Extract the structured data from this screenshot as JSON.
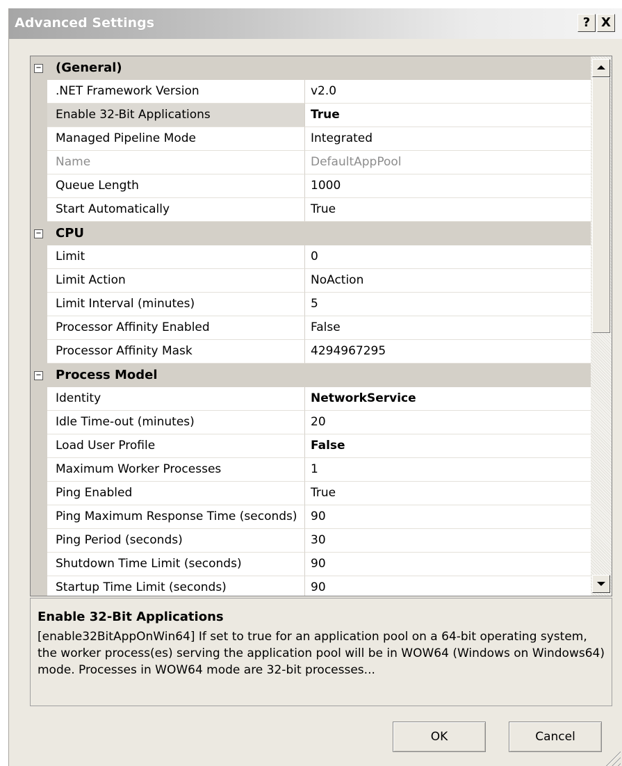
{
  "window": {
    "title": "Advanced Settings",
    "help_label": "?",
    "close_label": "X"
  },
  "property_grid": {
    "categories": [
      {
        "label": "(General)",
        "expander": "−",
        "properties": [
          {
            "name": ".NET Framework Version",
            "value": "v2.0"
          },
          {
            "name": "Enable 32-Bit Applications",
            "value": "True"
          },
          {
            "name": "Managed Pipeline Mode",
            "value": "Integrated"
          },
          {
            "name": "Name",
            "value": "DefaultAppPool"
          },
          {
            "name": "Queue Length",
            "value": "1000"
          },
          {
            "name": "Start Automatically",
            "value": "True"
          }
        ]
      },
      {
        "label": "CPU",
        "expander": "−",
        "properties": [
          {
            "name": "Limit",
            "value": "0"
          },
          {
            "name": "Limit Action",
            "value": "NoAction"
          },
          {
            "name": "Limit Interval (minutes)",
            "value": "5"
          },
          {
            "name": "Processor Affinity Enabled",
            "value": "False"
          },
          {
            "name": "Processor Affinity Mask",
            "value": "4294967295"
          }
        ]
      },
      {
        "label": "Process Model",
        "expander": "−",
        "properties": [
          {
            "name": "Identity",
            "value": "NetworkService"
          },
          {
            "name": "Idle Time-out (minutes)",
            "value": "20"
          },
          {
            "name": "Load User Profile",
            "value": "False"
          },
          {
            "name": "Maximum Worker Processes",
            "value": "1"
          },
          {
            "name": "Ping Enabled",
            "value": "True"
          },
          {
            "name": "Ping Maximum Response Time (seconds)",
            "value": "90"
          },
          {
            "name": "Ping Period (seconds)",
            "value": "30"
          },
          {
            "name": "Shutdown Time Limit (seconds)",
            "value": "90"
          },
          {
            "name": "Startup Time Limit (seconds)",
            "value": "90"
          }
        ]
      }
    ]
  },
  "description": {
    "title": "Enable 32-Bit Applications",
    "text": "[enable32BitAppOnWin64] If set to true for an application pool on a 64-bit operating system, the worker process(es) serving the application pool will be in WOW64 (Windows on Windows64) mode. Processes in WOW64 mode are 32-bit processes..."
  },
  "buttons": {
    "ok": "OK",
    "cancel": "Cancel"
  }
}
